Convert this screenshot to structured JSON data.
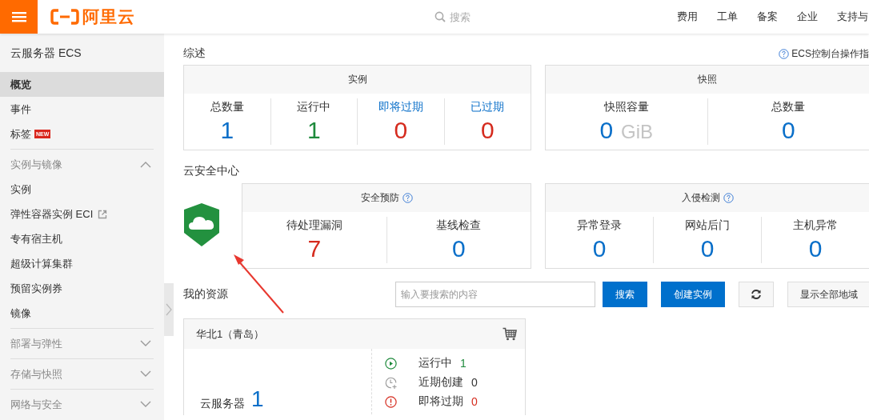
{
  "topbar": {
    "logo": "阿里云",
    "search": {
      "placeholder": "搜索"
    },
    "links": [
      "费用",
      "工单",
      "备案",
      "企业",
      "支持与"
    ]
  },
  "sidebar": {
    "title": "云服务器 ECS",
    "items": [
      {
        "label": "概览",
        "selected": true
      },
      {
        "label": "事件",
        "selected": false
      },
      {
        "label": "标签",
        "badge": "NEW",
        "selected": false
      }
    ],
    "groups": [
      {
        "label": "实例与镜像",
        "expanded": true,
        "items": [
          {
            "label": "实例",
            "selected": false,
            "external": false
          },
          {
            "label": "弹性容器实例 ECI",
            "selected": false,
            "external": true
          },
          {
            "label": "专有宿主机",
            "selected": false,
            "external": false
          },
          {
            "label": "超级计算集群",
            "selected": false,
            "external": false
          },
          {
            "label": "预留实例券",
            "selected": false,
            "external": false
          },
          {
            "label": "镜像",
            "selected": false,
            "external": false
          }
        ]
      },
      {
        "label": "部署与弹性",
        "expanded": false
      },
      {
        "label": "存储与快照",
        "expanded": false
      },
      {
        "label": "网络与安全",
        "expanded": false
      }
    ]
  },
  "overview": {
    "title": "综述",
    "guide_link": "ECS控制台操作指",
    "cards": [
      {
        "title": "实例",
        "help": false,
        "stats": [
          {
            "label": "总数量",
            "value": "1",
            "color": "#0a6fc9",
            "link": false
          },
          {
            "label": "运行中",
            "value": "1",
            "color": "#1e8a3c",
            "link": false
          },
          {
            "label": "即将过期",
            "value": "0",
            "color": "#d52b1e",
            "link": true
          },
          {
            "label": "已过期",
            "value": "0",
            "color": "#d52b1e",
            "link": true
          }
        ]
      },
      {
        "title": "快照",
        "help": false,
        "stats": [
          {
            "label": "快照容量",
            "value": "0",
            "unit": "GiB",
            "color": "#0a6fc9",
            "link": false
          },
          {
            "label": "总数量",
            "value": "0",
            "color": "#0a6fc9",
            "link": false
          }
        ]
      }
    ]
  },
  "security": {
    "title": "云安全中心",
    "cards": [
      {
        "title": "安全预防",
        "help": true,
        "stats": [
          {
            "label": "待处理漏洞",
            "value": "7",
            "color": "#d52b1e",
            "link": false
          },
          {
            "label": "基线检查",
            "value": "0",
            "color": "#0a6fc9",
            "link": false
          }
        ]
      },
      {
        "title": "入侵检测",
        "help": true,
        "stats": [
          {
            "label": "异常登录",
            "value": "0",
            "color": "#0a6fc9",
            "link": false
          },
          {
            "label": "网站后门",
            "value": "0",
            "color": "#0a6fc9",
            "link": false
          },
          {
            "label": "主机异常",
            "value": "0",
            "color": "#0a6fc9",
            "link": false
          }
        ]
      }
    ]
  },
  "resources": {
    "title": "我的资源",
    "search": {
      "placeholder": "输入要搜索的内容"
    },
    "buttons": [
      {
        "kind": "primary",
        "label": "搜索"
      },
      {
        "kind": "primary",
        "label": "创建实例"
      },
      {
        "kind": "refresh"
      },
      {
        "kind": "default",
        "label": "显示全部地域"
      }
    ],
    "region": {
      "name": "华北1（青岛）",
      "product": "云服务器",
      "count": "1",
      "statuses": [
        {
          "kind": "running",
          "label": "运行中",
          "value": "1",
          "color": "#1e8a3c"
        },
        {
          "kind": "recent",
          "label": "近期创建",
          "value": "0",
          "color": "#333333"
        },
        {
          "kind": "expiring",
          "label": "即将过期",
          "value": "0",
          "color": "#d52b1e"
        }
      ]
    }
  }
}
